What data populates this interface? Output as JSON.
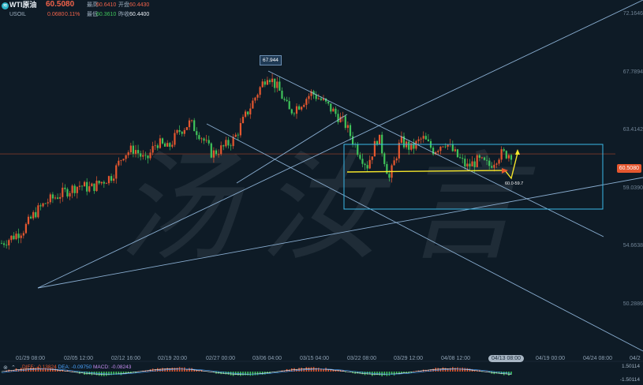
{
  "header": {
    "symbol": "WTI原油",
    "price": "60.5080",
    "ticker": "USOIL",
    "change": "0.0680",
    "change_pct": "0.11%",
    "quotes": [
      {
        "label": "最高",
        "value": "60.6410"
      },
      {
        "label": "开盘",
        "value": "60.4430"
      },
      {
        "label": "最低",
        "value": "60.3610"
      },
      {
        "label": "昨收",
        "value": "60.4400"
      }
    ]
  },
  "price_tag": "60.5080",
  "annotations": {
    "high": "67.944",
    "target": "60.0-59.7"
  },
  "watermark": "汤汝言",
  "chart_data": {
    "type": "candlestick",
    "x_ticks": [
      "01/29 08:00",
      "02/05 12:00",
      "02/12 16:00",
      "02/19 20:00",
      "02/27 00:00",
      "03/06 04:00",
      "03/15 04:00",
      "03/22 08:00",
      "03/29 12:00",
      "04/08 12:00",
      "04/19 00:00",
      "04/24 08:00",
      "04/2"
    ],
    "y_ticks": [
      "72.1646",
      "67.7894",
      "63.4142",
      "59.0390",
      "54.6638",
      "50.2886"
    ],
    "ylim": [
      46.5,
      73.5
    ],
    "series_close_path": [
      52.2,
      52.8,
      53.5,
      55.0,
      56.0,
      56.6,
      57.1,
      57.6,
      57.3,
      57.9,
      58.5,
      60.5,
      61.0,
      59.8,
      61.6,
      61.0,
      62.6,
      63.4,
      62.2,
      60.5,
      61.1,
      61.9,
      64.0,
      66.0,
      67.94,
      66.5,
      64.4,
      65.2,
      66.2,
      65.4,
      64.4,
      63.3,
      61.1,
      59.4,
      62.2,
      58.2,
      61.7,
      61.0,
      62.0,
      60.8,
      61.7,
      60.4,
      59.3,
      59.9,
      59.4,
      60.5,
      60.51
    ],
    "current_price": 60.508
  },
  "macd": {
    "diff_label": "DIFF: -0.13824",
    "dea_label": "DEA: -0.09750",
    "macd_label": "MACD: -0.08243",
    "upper": "1.50114",
    "lower": "-1.50114"
  },
  "date_badge": "04/13 08:00",
  "colors": {
    "up": "#e5572f",
    "down": "#3fc35a",
    "trend": "#9fc7ee",
    "box": "#39b8e8",
    "arrow": "#f5e62a"
  }
}
